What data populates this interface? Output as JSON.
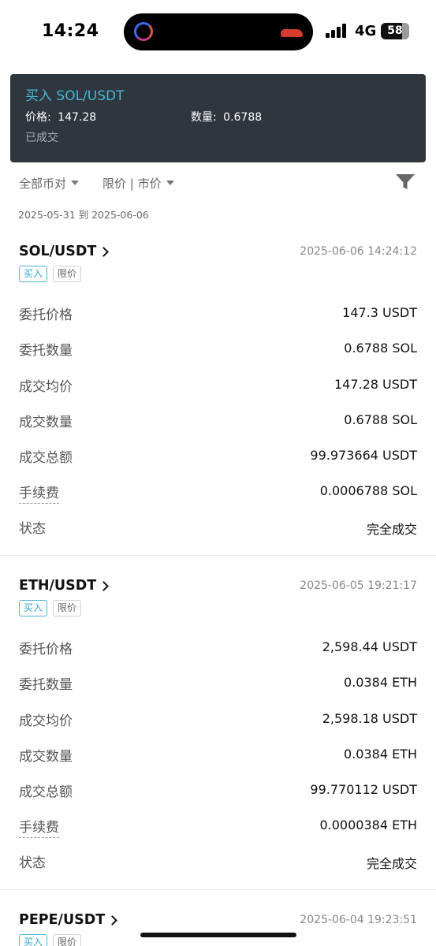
{
  "status_bar": {
    "time": "14:24",
    "network": "4G",
    "battery": "58"
  },
  "toast": {
    "title": "买入 SOL/USDT",
    "price_label": "价格:",
    "price_value": "147.28",
    "qty_label": "数量:",
    "qty_value": "0.6788",
    "status": "已成交"
  },
  "filters": {
    "pair_filter": "全部币对",
    "type_filter": "限价 | 市价",
    "filter_icon": "funnel-icon",
    "date_range": "2025-05-31 到 2025-06-06"
  },
  "orders": [
    {
      "pair": "SOL/USDT",
      "time": "2025-06-06 14:24:12",
      "side": "买入",
      "type": "限价",
      "rows": [
        {
          "label": "委托价格",
          "value": "147.3 USDT"
        },
        {
          "label": "委托数量",
          "value": "0.6788 SOL"
        },
        {
          "label": "成交均价",
          "value": "147.28 USDT"
        },
        {
          "label": "成交数量",
          "value": "0.6788 SOL"
        },
        {
          "label": "成交总额",
          "value": "99.973664 USDT"
        },
        {
          "label": "手续费",
          "value": "0.0006788 SOL"
        },
        {
          "label": "状态",
          "value": "完全成交"
        }
      ]
    },
    {
      "pair": "ETH/USDT",
      "time": "2025-06-05 19:21:17",
      "side": "买入",
      "type": "限价",
      "rows": [
        {
          "label": "委托价格",
          "value": "2,598.44 USDT"
        },
        {
          "label": "委托数量",
          "value": "0.0384 ETH"
        },
        {
          "label": "成交均价",
          "value": "2,598.18 USDT"
        },
        {
          "label": "成交数量",
          "value": "0.0384 ETH"
        },
        {
          "label": "成交总额",
          "value": "99.770112 USDT"
        },
        {
          "label": "手续费",
          "value": "0.0000384 ETH"
        },
        {
          "label": "状态",
          "value": "完全成交"
        }
      ]
    },
    {
      "pair": "PEPE/USDT",
      "time": "2025-06-04 19:23:51",
      "side": "买入",
      "type": "限价",
      "rows": []
    }
  ],
  "colors": {
    "accent": "#43b8d9",
    "toast_bg": "#2f363d"
  }
}
